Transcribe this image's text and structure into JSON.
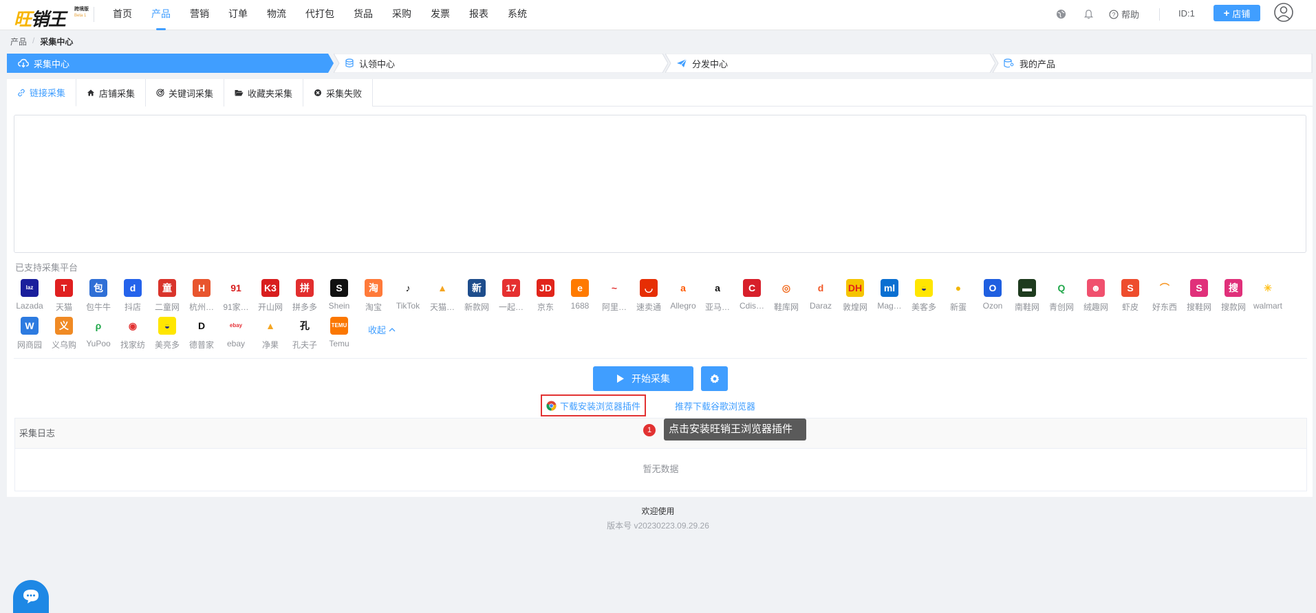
{
  "logo": {
    "text": "旺销王",
    "sub1": "跨境版",
    "sub2": "Beta 1"
  },
  "nav": {
    "items": [
      "首页",
      "产品",
      "营销",
      "订单",
      "物流",
      "代打包",
      "货品",
      "采购",
      "发票",
      "报表",
      "系统"
    ],
    "active_index": 1,
    "help_label": "帮助",
    "id_label": "ID:1",
    "shop_button": "店铺"
  },
  "breadcrumb": {
    "root": "产品",
    "current": "采集中心"
  },
  "steps": [
    "采集中心",
    "认领中心",
    "分发中心",
    "我的产品"
  ],
  "tabs": [
    "链接采集",
    "店铺采集",
    "关键词采集",
    "收藏夹采集",
    "采集失败"
  ],
  "textarea_value": "",
  "supported_title": "已支持采集平台",
  "platforms": [
    {
      "name": "Lazada",
      "glyph": "laz",
      "color": "#1a1f9c"
    },
    {
      "name": "天猫",
      "glyph": "T",
      "color": "#e02020"
    },
    {
      "name": "包牛牛",
      "glyph": "包",
      "color": "#2f6fd6"
    },
    {
      "name": "抖店",
      "glyph": "d",
      "color": "#2563eb"
    },
    {
      "name": "二童网",
      "glyph": "童",
      "color": "#d9342b"
    },
    {
      "name": "杭州…",
      "glyph": "H",
      "color": "#e8552e"
    },
    {
      "name": "91家…",
      "glyph": "91",
      "color": "#ffffff"
    },
    {
      "name": "开山网",
      "glyph": "K3",
      "color": "#d81e1e"
    },
    {
      "name": "拼多多",
      "glyph": "拼",
      "color": "#e22e2e"
    },
    {
      "name": "Shein",
      "glyph": "S",
      "color": "#111111"
    },
    {
      "name": "淘宝",
      "glyph": "淘",
      "color": "#ff7a3a"
    },
    {
      "name": "TikTok",
      "glyph": "♪",
      "color": "#ffffff"
    },
    {
      "name": "天猫…",
      "glyph": "▲",
      "color": "#ffffff"
    },
    {
      "name": "新款网",
      "glyph": "新",
      "color": "#1e4d8c"
    },
    {
      "name": "一起…",
      "glyph": "17",
      "color": "#e53030"
    },
    {
      "name": "京东",
      "glyph": "JD",
      "color": "#e1251b"
    },
    {
      "name": "1688",
      "glyph": "e",
      "color": "#ff7a00"
    },
    {
      "name": "阿里…",
      "glyph": "~",
      "color": "#ffffff"
    },
    {
      "name": "速卖通",
      "glyph": "◡",
      "color": "#e62e04"
    },
    {
      "name": "Allegro",
      "glyph": "a",
      "color": "#ffffff"
    },
    {
      "name": "亚马…",
      "glyph": "a",
      "color": "#ffffff"
    },
    {
      "name": "Cdis…",
      "glyph": "C",
      "color": "#d71f2a"
    },
    {
      "name": "鞋库网",
      "glyph": "◎",
      "color": "#ffffff"
    },
    {
      "name": "Daraz",
      "glyph": "d",
      "color": "#ffffff"
    },
    {
      "name": "敦煌网",
      "glyph": "DH",
      "color": "#f5c400"
    },
    {
      "name": "Mag…",
      "glyph": "ml",
      "color": "#0a6fd1"
    },
    {
      "name": "美客多",
      "glyph": "◒",
      "color": "#ffe600"
    },
    {
      "name": "新蛋",
      "glyph": "●",
      "color": "#ffffff"
    },
    {
      "name": "Ozon",
      "glyph": "O",
      "color": "#1f5fe0"
    },
    {
      "name": "南鞋网",
      "glyph": "▬",
      "color": "#1e3b1e"
    },
    {
      "name": "青创网",
      "glyph": "Q",
      "color": "#ffffff"
    },
    {
      "name": "绒趣网",
      "glyph": "☻",
      "color": "#f0506e"
    },
    {
      "name": "虾皮",
      "glyph": "S",
      "color": "#ee4d2d"
    },
    {
      "name": "好东西",
      "glyph": "⌒",
      "color": "#ffffff"
    },
    {
      "name": "搜鞋网",
      "glyph": "S",
      "color": "#e0307a"
    },
    {
      "name": "搜款网",
      "glyph": "搜",
      "color": "#e0307a"
    },
    {
      "name": "walmart",
      "glyph": "✳",
      "color": "#ffffff"
    },
    {
      "name": "网商园",
      "glyph": "W",
      "color": "#2d7be0"
    },
    {
      "name": "义乌购",
      "glyph": "义",
      "color": "#f08a24"
    },
    {
      "name": "YuPoo",
      "glyph": "ρ",
      "color": "#ffffff"
    },
    {
      "name": "找家纺",
      "glyph": "◉",
      "color": "#ffffff"
    },
    {
      "name": "美亮多",
      "glyph": "◒",
      "color": "#ffe600"
    },
    {
      "name": "德普家",
      "glyph": "D",
      "color": "#ffffff"
    },
    {
      "name": "ebay",
      "glyph": "ebay",
      "color": "#ffffff"
    },
    {
      "name": "净果",
      "glyph": "▲",
      "color": "#ffffff"
    },
    {
      "name": "孔夫子",
      "glyph": "孔",
      "color": "#ffffff"
    },
    {
      "name": "Temu",
      "glyph": "TEMU",
      "color": "#fb7701"
    }
  ],
  "collapse_label": "收起",
  "start_button": "开始采集",
  "download_plugin": "下载安装浏览器插件",
  "recommend_chrome": "推荐下载谷歌浏览器",
  "tooltip": {
    "num": "1",
    "text": "点击安装旺销王浏览器插件"
  },
  "log": {
    "title": "采集日志",
    "empty": "暂无数据"
  },
  "footer": {
    "welcome": "欢迎使用",
    "version": "版本号 v20230223.09.29.26"
  },
  "colors": {
    "primary": "#409eff",
    "highlight": "#e23232"
  }
}
